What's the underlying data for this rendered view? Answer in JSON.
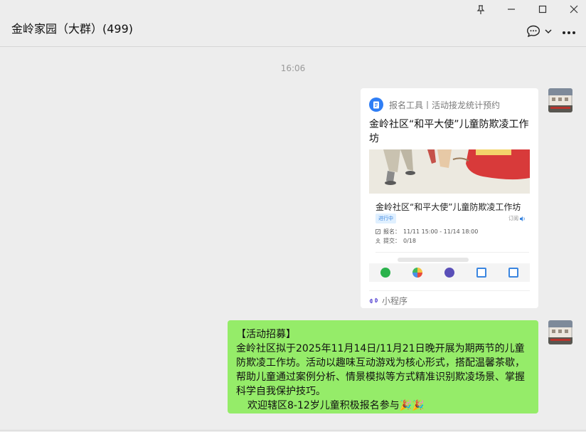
{
  "chat": {
    "title": "金岭家园（大群）(499)"
  },
  "timestamp": "16:06",
  "mini_program_card": {
    "source": "报名工具丨活动接龙统计预约",
    "title": "金岭社区“和平大使”儿童防欺凌工作坊",
    "preview": {
      "inner_title": "金岭社区“和平大使”儿童防欺凌工作坊",
      "status": "进行中",
      "subscribe": "订阅",
      "signup_label": "报名：",
      "signup_time": "11/11 15:00 - 11/14 18:00",
      "submit_label": "提交：",
      "submit_count": "0/18"
    },
    "footer": "小程序"
  },
  "message": {
    "line1": "【活动招募】",
    "line2": "金岭社区拟于2025年11月14日/11月21日晚开展为期两节的儿童防欺凌工作坊。活动以趣味互动游戏为核心形式，搭配温馨茶歇，帮助儿童通过案例分析、情景模拟等方式精准识别欺凌场景、掌握科学自我保护技巧。",
    "line3": "欢迎辖区8-12岁儿童积极报名参与🎉🎉"
  },
  "colors": {
    "background": "#ededed",
    "bubble_self": "#95ec69",
    "card": "#ffffff",
    "accent_blue": "#2f7ef5"
  }
}
